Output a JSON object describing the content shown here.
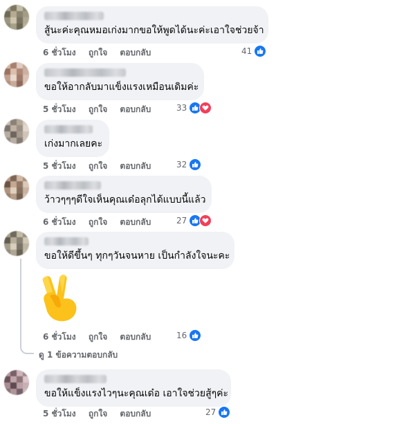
{
  "comments": [
    {
      "text": "สู้นะค่ะคุณหมอเก่งมากขอให้พูดได้นะค่ะเอาใจช่วยจ้า",
      "time": "6 ชั่วโมง",
      "like": "ถูกใจ",
      "reply": "ตอบกลับ",
      "count": "41"
    },
    {
      "text": "ขอให้อากลับมาแข็งแรงเหมือนเดิมค่ะ",
      "time": "5 ชั่วโมง",
      "like": "ถูกใจ",
      "reply": "ตอบกลับ",
      "count": "33"
    },
    {
      "text": "เก่งมากเลยคะ",
      "time": "5 ชั่วโมง",
      "like": "ถูกใจ",
      "reply": "ตอบกลับ",
      "count": "32"
    },
    {
      "text": "ว้าวๆๆๆดีใจเห็นคุณเด๋อลุกได้แบบนี้แล้ว",
      "time": "6 ชั่วโมง",
      "like": "ถูกใจ",
      "reply": "ตอบกลับ",
      "count": "27"
    },
    {
      "text": "ขอให้ดีขึ้นๆ ทุกๆวันจนหาย เป็นกำลังใจนะคะ",
      "time": "6 ชั่วโมง",
      "like": "ถูกใจ",
      "reply": "ตอบกลับ",
      "count": "16",
      "view_replies": "ดู 1 ข้อความตอบกลับ"
    },
    {
      "text": "ขอให้แข็งแรงไวๆนะคุณเด๋อ เอาใจช่วยสู้ๆค่ะ",
      "time": "5 ชั่วโมง",
      "like": "ถูกใจ",
      "reply": "ตอบกลับ",
      "count": "27"
    }
  ],
  "colors": {
    "like": "#1877f2",
    "love": "#f33e58",
    "bubble": "#f0f2f5",
    "meta_text": "#65676b"
  },
  "icons": {
    "like": "thumbs-up-icon",
    "love": "heart-icon",
    "sticker": "victory-hand-emoji"
  }
}
